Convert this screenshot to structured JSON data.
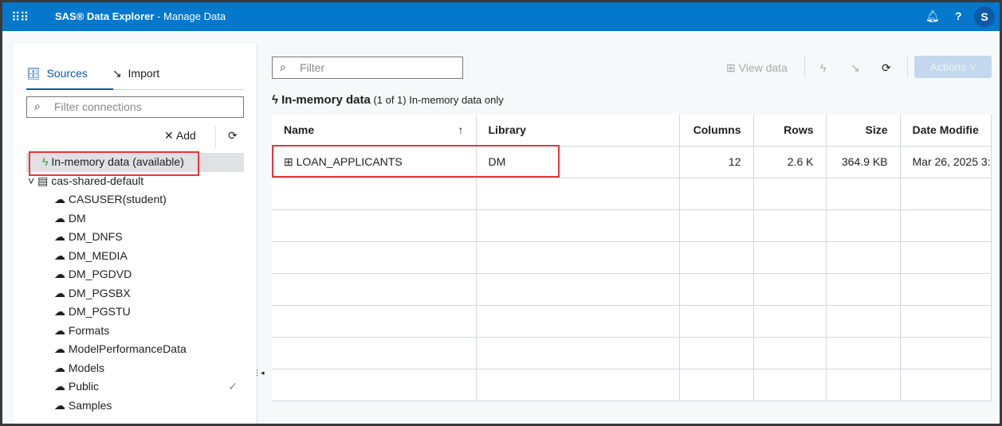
{
  "header": {
    "app": "SAS® Data Explorer",
    "page": "- Manage Data",
    "user_initial": "S",
    "icons": [
      "apps-grid-icon",
      "bell-icon",
      "help-icon"
    ]
  },
  "left": {
    "tabs": [
      {
        "label": "Sources"
      },
      {
        "label": "Import"
      }
    ],
    "filter_placeholder": "Filter connections",
    "add_label": "Add",
    "inmemory": "In-memory data (available)",
    "server": "cas-shared-default",
    "libraries": [
      "CASUSER(student)",
      "DM",
      "DM_DNFS",
      "DM_MEDIA",
      "DM_PGDVD",
      "DM_PGSBX",
      "DM_PGSTU",
      "Formats",
      "ModelPerformanceData",
      "Models",
      "Public",
      "Samples"
    ]
  },
  "right": {
    "filter_placeholder": "Filter",
    "view_data": "View data",
    "actions": "Actions ˅",
    "section_title": "In-memory data",
    "section_count": "(1 of 1)",
    "section_note": "In-memory data only",
    "columns": [
      "Name",
      "Library",
      "Columns",
      "Rows",
      "Size",
      "Date Modifie"
    ],
    "rows": [
      {
        "name": "LOAN_APPLICANTS",
        "library": "DM",
        "columns": "12",
        "rows": "2.6 K",
        "size": "364.9 KB",
        "date": "Mar 26, 2025 3:"
      }
    ]
  },
  "colors": {
    "header": "#0378cd",
    "accent": "#0b5aa6",
    "highlight": "#e8363a",
    "inmemory": "#2e9e3a"
  }
}
